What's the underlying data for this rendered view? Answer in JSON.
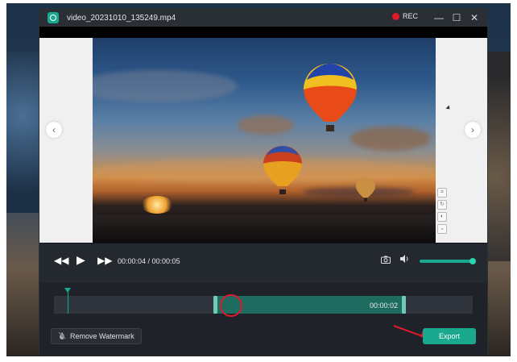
{
  "window": {
    "title": "video_20231010_135249.mp4",
    "rec_label": "REC"
  },
  "window_controls": {
    "minimize": "—",
    "maximize": "☐",
    "close": "✕"
  },
  "preview": {
    "prev_symbol": "‹",
    "next_symbol": "›"
  },
  "controls": {
    "rewind_symbol": "◀◀",
    "play_symbol": "▶",
    "forward_symbol": "▶▶",
    "timecode": "00:00:04 / 00:00:05",
    "volume_level": 1.0
  },
  "timeline": {
    "selection_duration": "00:00:02"
  },
  "bottom": {
    "remove_watermark_label": "Remove Watermark",
    "export_label": "Export"
  },
  "icons": {
    "app_logo": "app-logo-icon",
    "camera": "camera-icon",
    "volume": "volume-icon",
    "watermark": "watermark-off-icon"
  },
  "colors": {
    "accent": "#1aa88f",
    "record": "#e0192b",
    "annotation": "#e0192b"
  }
}
